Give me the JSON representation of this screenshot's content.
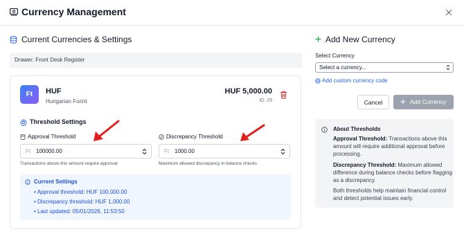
{
  "header": {
    "title": "Currency Management",
    "icon": "banknote-icon",
    "close_icon": "close-icon"
  },
  "left": {
    "title": "Current Currencies & Settings",
    "drawer_label": "Drawer: Front Desk Register",
    "currency": {
      "badge": "Ft",
      "code": "HUF",
      "name": "Hungarian Forint",
      "amount": "HUF 5,000.00",
      "id_text": "ID: 29"
    },
    "threshold_settings": {
      "title": "Threshold Settings",
      "approval": {
        "label": "Approval Threshold",
        "prefix": "Ft",
        "value": "100000.00",
        "help": "Transactions above this amount require approval"
      },
      "discrepancy": {
        "label": "Discrepancy Threshold",
        "prefix": "Ft",
        "value": "1000.00",
        "help": "Maximum allowed discrepancy in balance checks"
      }
    },
    "current_settings": {
      "title": "Current Settings",
      "lines": [
        "• Approval threshold: HUF 100,000.00",
        "• Discrepancy threshold: HUF 1,000.00",
        "• Last updated: 05/01/2026, 11:53:50"
      ]
    }
  },
  "right": {
    "title": "Add New Currency",
    "select_label": "Select Currency",
    "select_value": "Select a currency...",
    "add_custom": "Add custom currency code",
    "cancel": "Cancel",
    "add_button": "Add Currency",
    "about": {
      "title": "About Thresholds",
      "approval_bold": "Approval Threshold:",
      "approval_text": " Transactions above this amount will require additional approval before processing.",
      "discrepancy_bold": "Discrepancy Threshold:",
      "discrepancy_text": " Maximum allowed difference during balance checks before flagging as a discrepancy.",
      "footer": "Both thresholds help maintain financial control and detect potential issues early."
    }
  },
  "colors": {
    "accent": "#2563eb",
    "danger": "#dc2626",
    "arrow": "#e11d1d",
    "badge_from": "#3b82f6",
    "badge_to": "#8b5cf6"
  }
}
